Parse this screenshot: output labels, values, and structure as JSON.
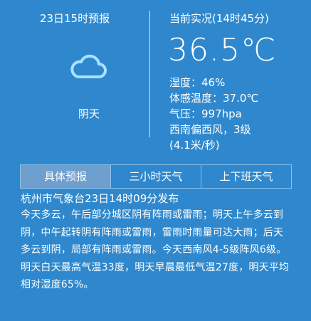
{
  "forecast": {
    "title": "23日15时预报",
    "condition": "阴天",
    "icon": "cloud-icon"
  },
  "current": {
    "title": "当前实况(14时45分)",
    "temperature": "36.5℃",
    "humidity": "湿度：46%",
    "feels_like": "体感温度：37.0℃",
    "pressure": "气压：997hpa",
    "wind": "西南偏西风，3级",
    "wind_speed": "(4.1米/秒)"
  },
  "tabs": [
    {
      "label": "具体预报",
      "active": true
    },
    {
      "label": "三小时天气",
      "active": false
    },
    {
      "label": "上下班天气",
      "active": false
    }
  ],
  "issue": "杭州市气象台23日14时09分发布",
  "forecast_text": "今天多云，午后部分城区阴有阵雨或雷雨；明天上午多云到阴，中午起转阴有阵雨或雷雨，雷雨时雨量可达大雨；后天多云到阴，局部有阵雨或雷雨。今天西南风4-5级阵风6级。明天白天最高气温33度，明天早晨最低气温27度，明天平均相对湿度65%。",
  "colors": {
    "background": "#2f88cd",
    "active_tab": "#6f9fce",
    "icon": "#a9e3ff"
  }
}
